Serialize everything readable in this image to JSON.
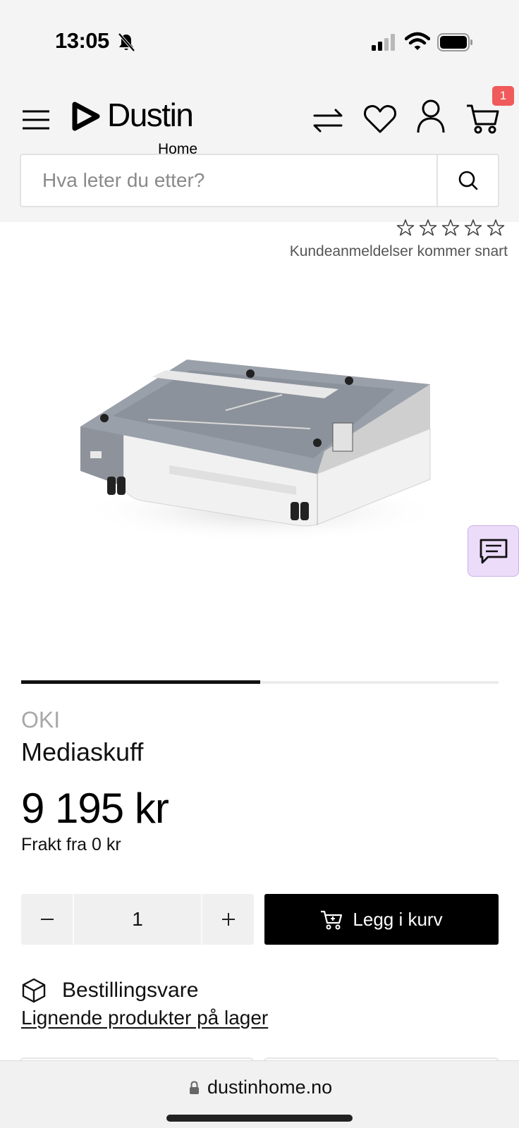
{
  "status_bar": {
    "time": "13:05"
  },
  "header": {
    "logo_text": "Dustin",
    "logo_sub": "Home",
    "cart_count": "1",
    "search": {
      "placeholder": "Hva leter du etter?"
    }
  },
  "rating": {
    "stars": 5,
    "filled": 0,
    "reviews_text": "Kundeanmeldelser kommer snart"
  },
  "carousel": {
    "progress": 0.5
  },
  "product": {
    "brand": "OKI",
    "name": "Mediaskuff",
    "price": "9 195 kr",
    "shipping": "Frakt fra 0 kr",
    "quantity": "1",
    "add_to_cart": "Legg i kurv",
    "availability": "Bestillingsvare",
    "similar_link": "Lignende produkter på lager"
  },
  "browser": {
    "url": "dustinhome.no"
  },
  "colors": {
    "badge": "#f05a5a",
    "chat_bg": "#ecdcfa",
    "button": "#000000"
  }
}
